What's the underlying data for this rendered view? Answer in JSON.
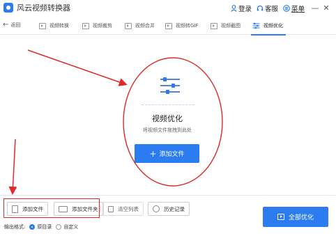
{
  "app": {
    "title": "风云视频转换器"
  },
  "titlebar": {
    "login_label": "登录",
    "service_label": "客服",
    "menu_label": "菜单",
    "minimize_label": "—",
    "close_label": "✕"
  },
  "nav": {
    "back_label": "返回",
    "tabs": [
      {
        "label": "视频转换",
        "active": false
      },
      {
        "label": "视频裁剪",
        "active": false
      },
      {
        "label": "视频合并",
        "active": false
      },
      {
        "label": "视频转GIF",
        "active": false
      },
      {
        "label": "视频截图",
        "active": false
      },
      {
        "label": "视频优化",
        "active": true
      }
    ]
  },
  "main": {
    "title": "视频优化",
    "hint": "将视频文件拖拽到此处",
    "add_button_label": "添加文件"
  },
  "toolbar": {
    "add_file_label": "添加文件",
    "add_folder_label": "添加文件夹",
    "clear_list_label": "清空列表",
    "history_label": "历史记录",
    "run_all_label": "全部优化"
  },
  "output": {
    "label": "输出格式:",
    "options": [
      {
        "label": "原目录",
        "selected": true
      },
      {
        "label": "自定义",
        "selected": false
      }
    ]
  },
  "colors": {
    "accent": "#2a7cf0",
    "annotation": "#e02a2a"
  }
}
